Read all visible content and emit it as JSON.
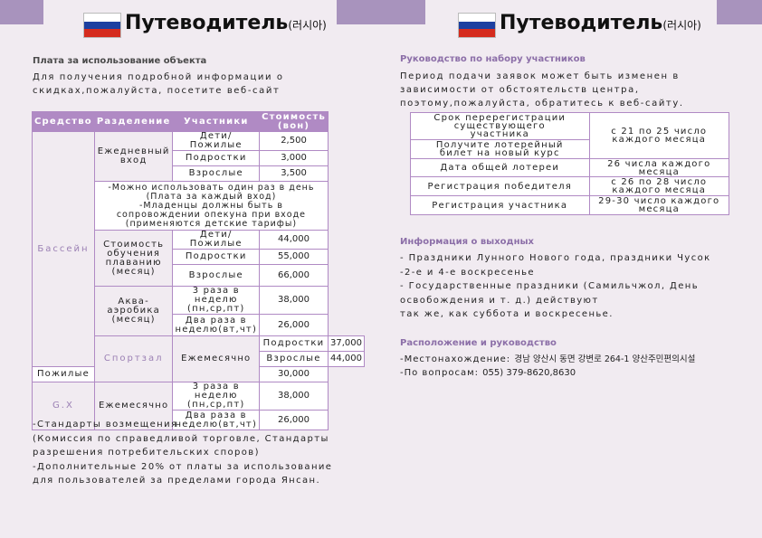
{
  "colors": {
    "accent": "#b08ac4",
    "tab": "#a893bd",
    "background": "#f1ebf1"
  },
  "left": {
    "title_ru": "Путеводитель",
    "title_ko": "(러시아)",
    "section_fee": "Плата за использование объекта",
    "intro": [
      "Для получения подробной информации о",
      "скидках,пожалуйста, посетите веб-сайт"
    ],
    "table": {
      "headers": [
        "Средство",
        "Разделение",
        "Участники",
        "Стоимость",
        "(вон)"
      ],
      "pool": "Бассейн",
      "daily": [
        "Ежедневный",
        "вход"
      ],
      "kids": "Дети/Пожилые",
      "teens": "Подростки",
      "adults": "Взрослые",
      "elderly": "Пожилые",
      "daily_values": [
        "2,500",
        "3,000",
        "3,500"
      ],
      "daily_note": [
        "-Можно использовать один раз в день",
        "(Плата за каждый вход)",
        "-Младенцы должны быть в",
        "сопровождении опекуна при входе",
        "(применяются детские тарифы)"
      ],
      "swim": [
        "Стоимость",
        "обучения",
        "плаванию",
        "(месяц)"
      ],
      "swim_values": [
        "44,000",
        "55,000",
        "66,000"
      ],
      "aqua": [
        "Аква-",
        "аэробика",
        "(месяц)"
      ],
      "aqua_3": [
        "3 раза в",
        "неделю",
        "(пн,ср,пт)"
      ],
      "aqua_2": [
        "Два раза в",
        "неделю(вт,чт)"
      ],
      "aqua_values": [
        "38,000",
        "26,000"
      ],
      "gym": "Спортзал",
      "monthly": "Ежемесячно",
      "gym_values": [
        "37,000",
        "44,000",
        "30,000"
      ],
      "gx": "G.X",
      "gx_values": [
        "38,000",
        "26,000"
      ]
    },
    "footer": [
      "-Стандарты возмещения",
      "(Комиссия по справедливой торговле, Стандарты",
      "разрешения потребительских споров)",
      "-Дополнительные 20% от платы за использование",
      "для пользователей за пределами города Янсан."
    ]
  },
  "right": {
    "title_ru": "Путеводитель",
    "title_ko": "(러시아)",
    "section_recruit": "Руководство по набору участников",
    "recruit_text": [
      "Период подачи заявок может быть изменен в",
      "зависимости от обстоятельств центра,",
      "поэтому,пожалуйста, обратитесь к веб-сайту."
    ],
    "reg_table": [
      {
        "label": [
          "Срок перерегистрации",
          "существующего",
          "участника"
        ],
        "value": [
          "с 21 по 25 число",
          "каждого месяца"
        ]
      },
      {
        "label": [
          "Получите лотерейный",
          "билет на новый курс"
        ],
        "value": []
      },
      {
        "label": [
          "Дата общей лотереи"
        ],
        "value": [
          "26 числа каждого",
          "месяца"
        ]
      },
      {
        "label": [
          "Регистрация победителя"
        ],
        "value": [
          "с 26 по 28 число",
          "каждого месяца"
        ]
      },
      {
        "label": [
          "Регистрация участника"
        ],
        "value": [
          "29-30 число каждого",
          "месяца"
        ]
      }
    ],
    "section_holidays": "Информация о выходных",
    "holidays": [
      "- Праздники Лунного Нового года, праздники Чусок",
      "-2-е и 4-е воскресенье",
      "- Государственные праздники (Самильчжол, День",
      "освобождения и т. д.) действуют",
      "так же, как суббота и воскресенье."
    ],
    "section_location": "Расположение и руководство",
    "address_label": "-Местонахождение:",
    "address": "경남 양산시 동면 강변로 264-1 양산주민편의시설",
    "phone_label": "-По вопросам:",
    "phone": "055) 379-8620,8630"
  }
}
